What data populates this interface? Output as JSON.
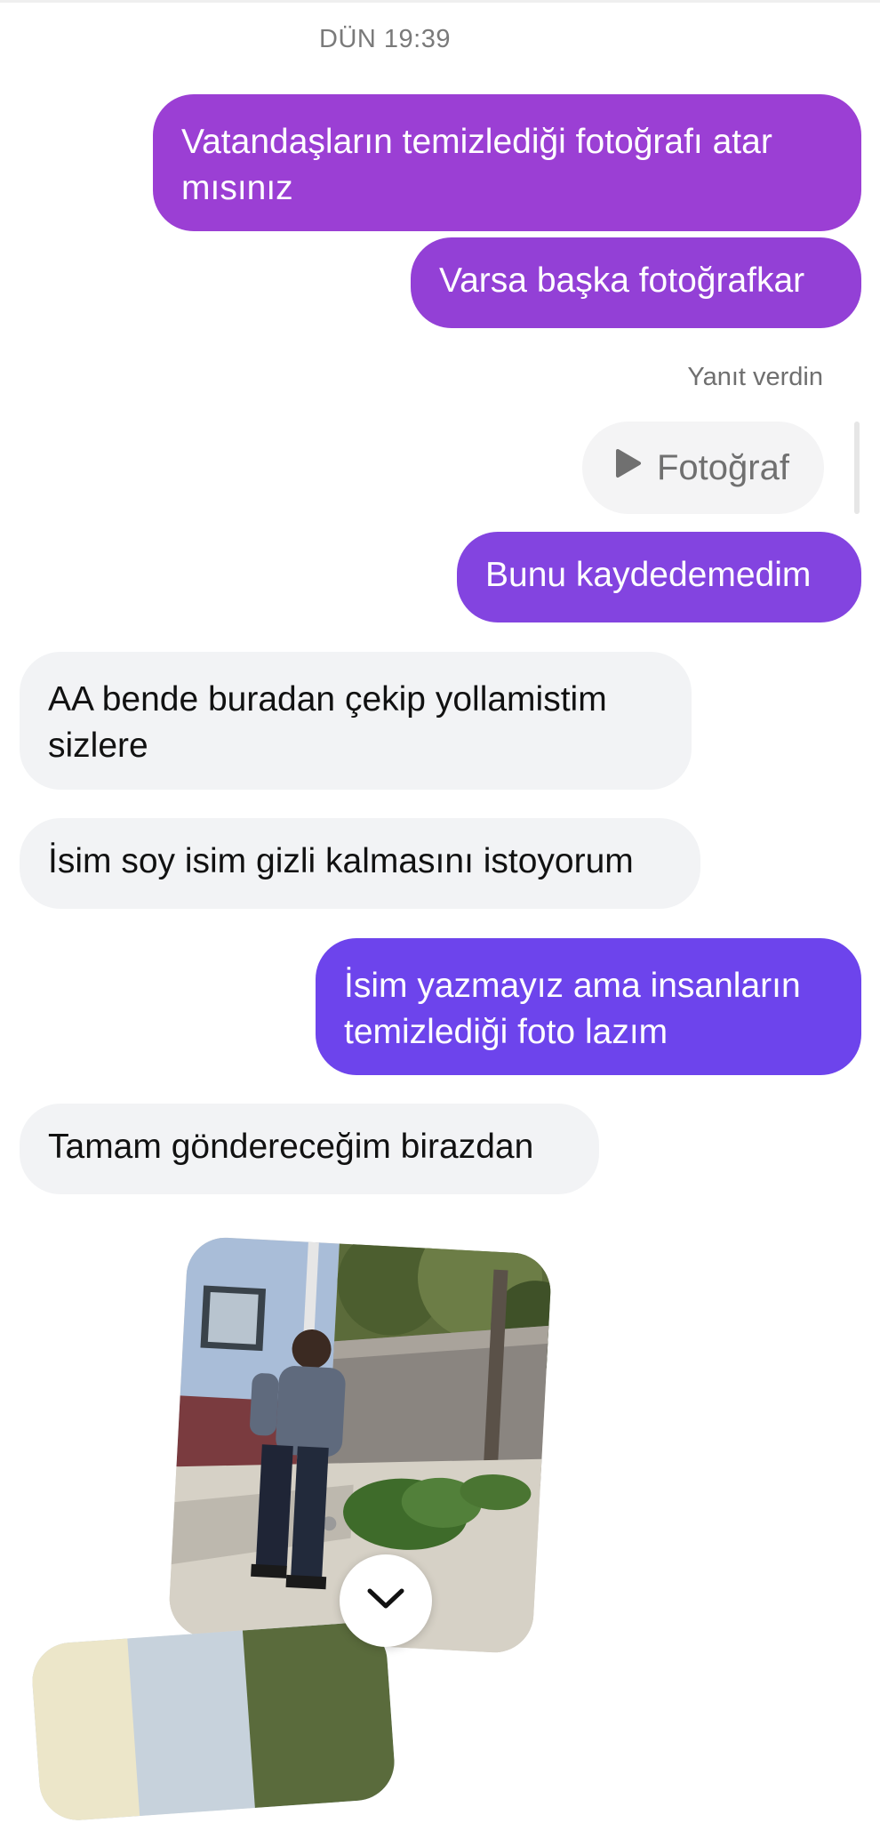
{
  "chat": {
    "timestamp": "DÜN 19:39",
    "messages": [
      {
        "from": "me",
        "text": "Vatandaşların temizlediği fotoğrafı atar\nmısınız",
        "color": "#9b3fd4"
      },
      {
        "from": "me",
        "text": "Varsa başka fotoğrafkar",
        "color": "#9340d6"
      },
      {
        "from": "me",
        "text": "Bunu kaydedemedim",
        "color": "#8344e0"
      },
      {
        "from": "them",
        "text": "AA bende buradan çekip yollamistim\nsizlere"
      },
      {
        "from": "them",
        "text": "İsim soy isim gizli kalmasını istoyorum"
      },
      {
        "from": "me",
        "text": "İsim yazmayız ama insanların\ntemizlediği foto lazım",
        "color": "#6d44ec"
      },
      {
        "from": "them",
        "text": "Tamam göndereceğim birazdan"
      }
    ],
    "reply": {
      "label": "Yanıt verdin",
      "chip_label": "Fotoğraf",
      "icon": "play-icon"
    },
    "scroll_down_icon": "chevron-down-icon",
    "colors": {
      "incoming_bg": "#f2f3f5",
      "outgoing_top": "#9b3fd4",
      "outgoing_bottom": "#6d44ec"
    }
  }
}
